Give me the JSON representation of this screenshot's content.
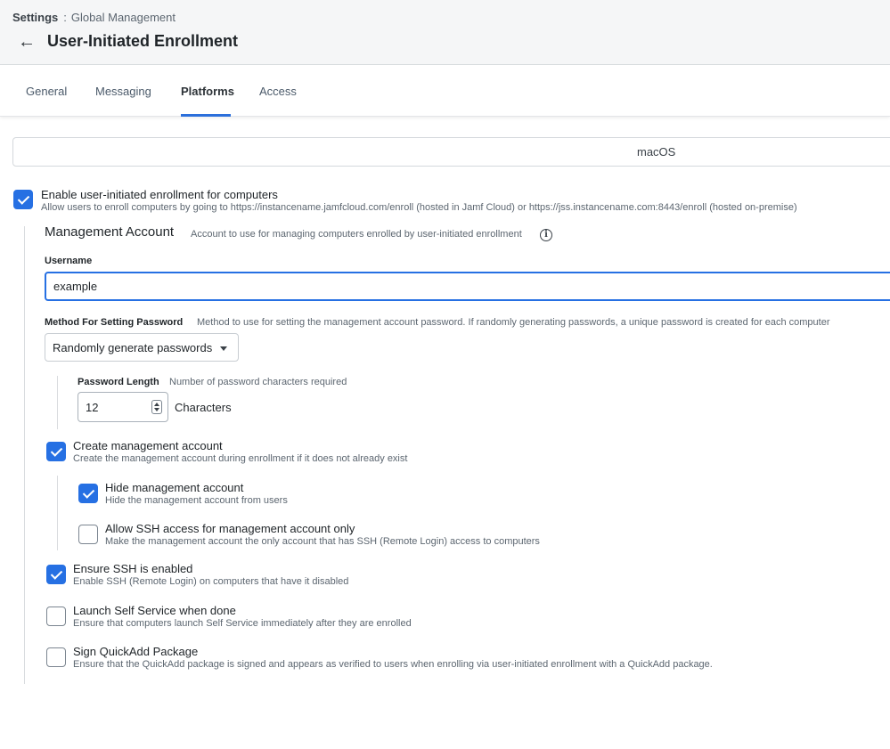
{
  "breadcrumb": {
    "root": "Settings",
    "separator": ":",
    "current": "Global Management"
  },
  "page": {
    "title": "User-Initiated Enrollment",
    "back_icon": "arrow-left-icon"
  },
  "tabs": [
    {
      "label": "General",
      "active": false
    },
    {
      "label": "Messaging",
      "active": false
    },
    {
      "label": "Platforms",
      "active": true
    },
    {
      "label": "Access",
      "active": false
    }
  ],
  "platform": {
    "label": "macOS"
  },
  "enable_enrollment": {
    "checked": true,
    "label": "Enable user-initiated enrollment for computers",
    "description": "Allow users to enroll computers by going to https://instancename.jamfcloud.com/enroll (hosted in Jamf Cloud) or https://jss.instancename.com:8443/enroll (hosted on-premise)"
  },
  "management_account": {
    "title": "Management Account",
    "description": "Account to use for managing computers enrolled by user-initiated enrollment",
    "info_icon": "info-icon"
  },
  "username": {
    "label": "Username",
    "value": "example"
  },
  "password_method": {
    "label": "Method For Setting Password",
    "description": "Method to use for setting the management account password. If randomly generating passwords, a unique password is created for each computer",
    "selected": "Randomly generate passwords"
  },
  "password_length": {
    "label": "Password Length",
    "description": "Number of password characters required",
    "value": "12",
    "unit": "Characters"
  },
  "options": {
    "create_account": {
      "checked": true,
      "label": "Create management account",
      "description": "Create the management account during enrollment if it does not already exist"
    },
    "hide_account": {
      "checked": true,
      "label": "Hide management account",
      "description": "Hide the management account from users"
    },
    "ssh_only": {
      "checked": false,
      "label": "Allow SSH access for management account only",
      "description": "Make the management account the only account that has SSH (Remote Login) access to computers"
    },
    "ensure_ssh": {
      "checked": true,
      "label": "Ensure SSH is enabled",
      "description": "Enable SSH (Remote Login) on computers that have it disabled"
    },
    "launch_self_service": {
      "checked": false,
      "label": "Launch Self Service when done",
      "description": "Ensure that computers launch Self Service immediately after they are enrolled"
    },
    "sign_quickadd": {
      "checked": false,
      "label": "Sign QuickAdd Package",
      "description": "Ensure that the QuickAdd package is signed and appears as verified to users when enrolling via user-initiated enrollment with a QuickAdd package."
    }
  },
  "colors": {
    "accent": "#2670e3",
    "header_bg": "#f5f6f7"
  }
}
